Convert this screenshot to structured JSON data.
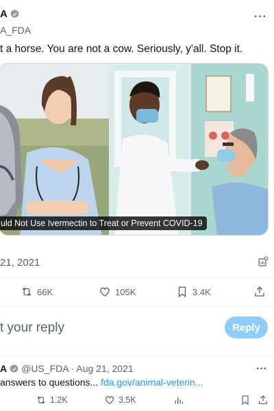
{
  "tweet": {
    "author_name": "A",
    "author_handle": "A_FDA",
    "text": "t a horse. You are not a cow. Seriously, y'all. Stop it.",
    "media_caption": "uld Not Use Ivermectin to Treat or Prevent COVID-19",
    "timestamp": "21, 2021",
    "stats": {
      "retweets": "66K",
      "likes": "105K",
      "bookmarks": "3.4K"
    }
  },
  "reply_box": {
    "placeholder": "t your reply",
    "button_label": "Reply"
  },
  "reply_tweet": {
    "author_name": "A",
    "handle": "@US_FDA",
    "date": "· Aug 21, 2021",
    "text": "answers to questions... ",
    "link": "fda.gov/animal-veterin...",
    "stats": {
      "retweets": "1.2K",
      "likes": "3.5K"
    }
  },
  "colors": {
    "accent": "#1d9bf0",
    "reply_button": "#8ecdf8",
    "muted_text": "#536471"
  },
  "icons": [
    "verified-badge-icon",
    "more-icon",
    "stats-icon",
    "retweet-icon",
    "like-icon",
    "bookmark-icon",
    "share-icon",
    "views-icon"
  ]
}
